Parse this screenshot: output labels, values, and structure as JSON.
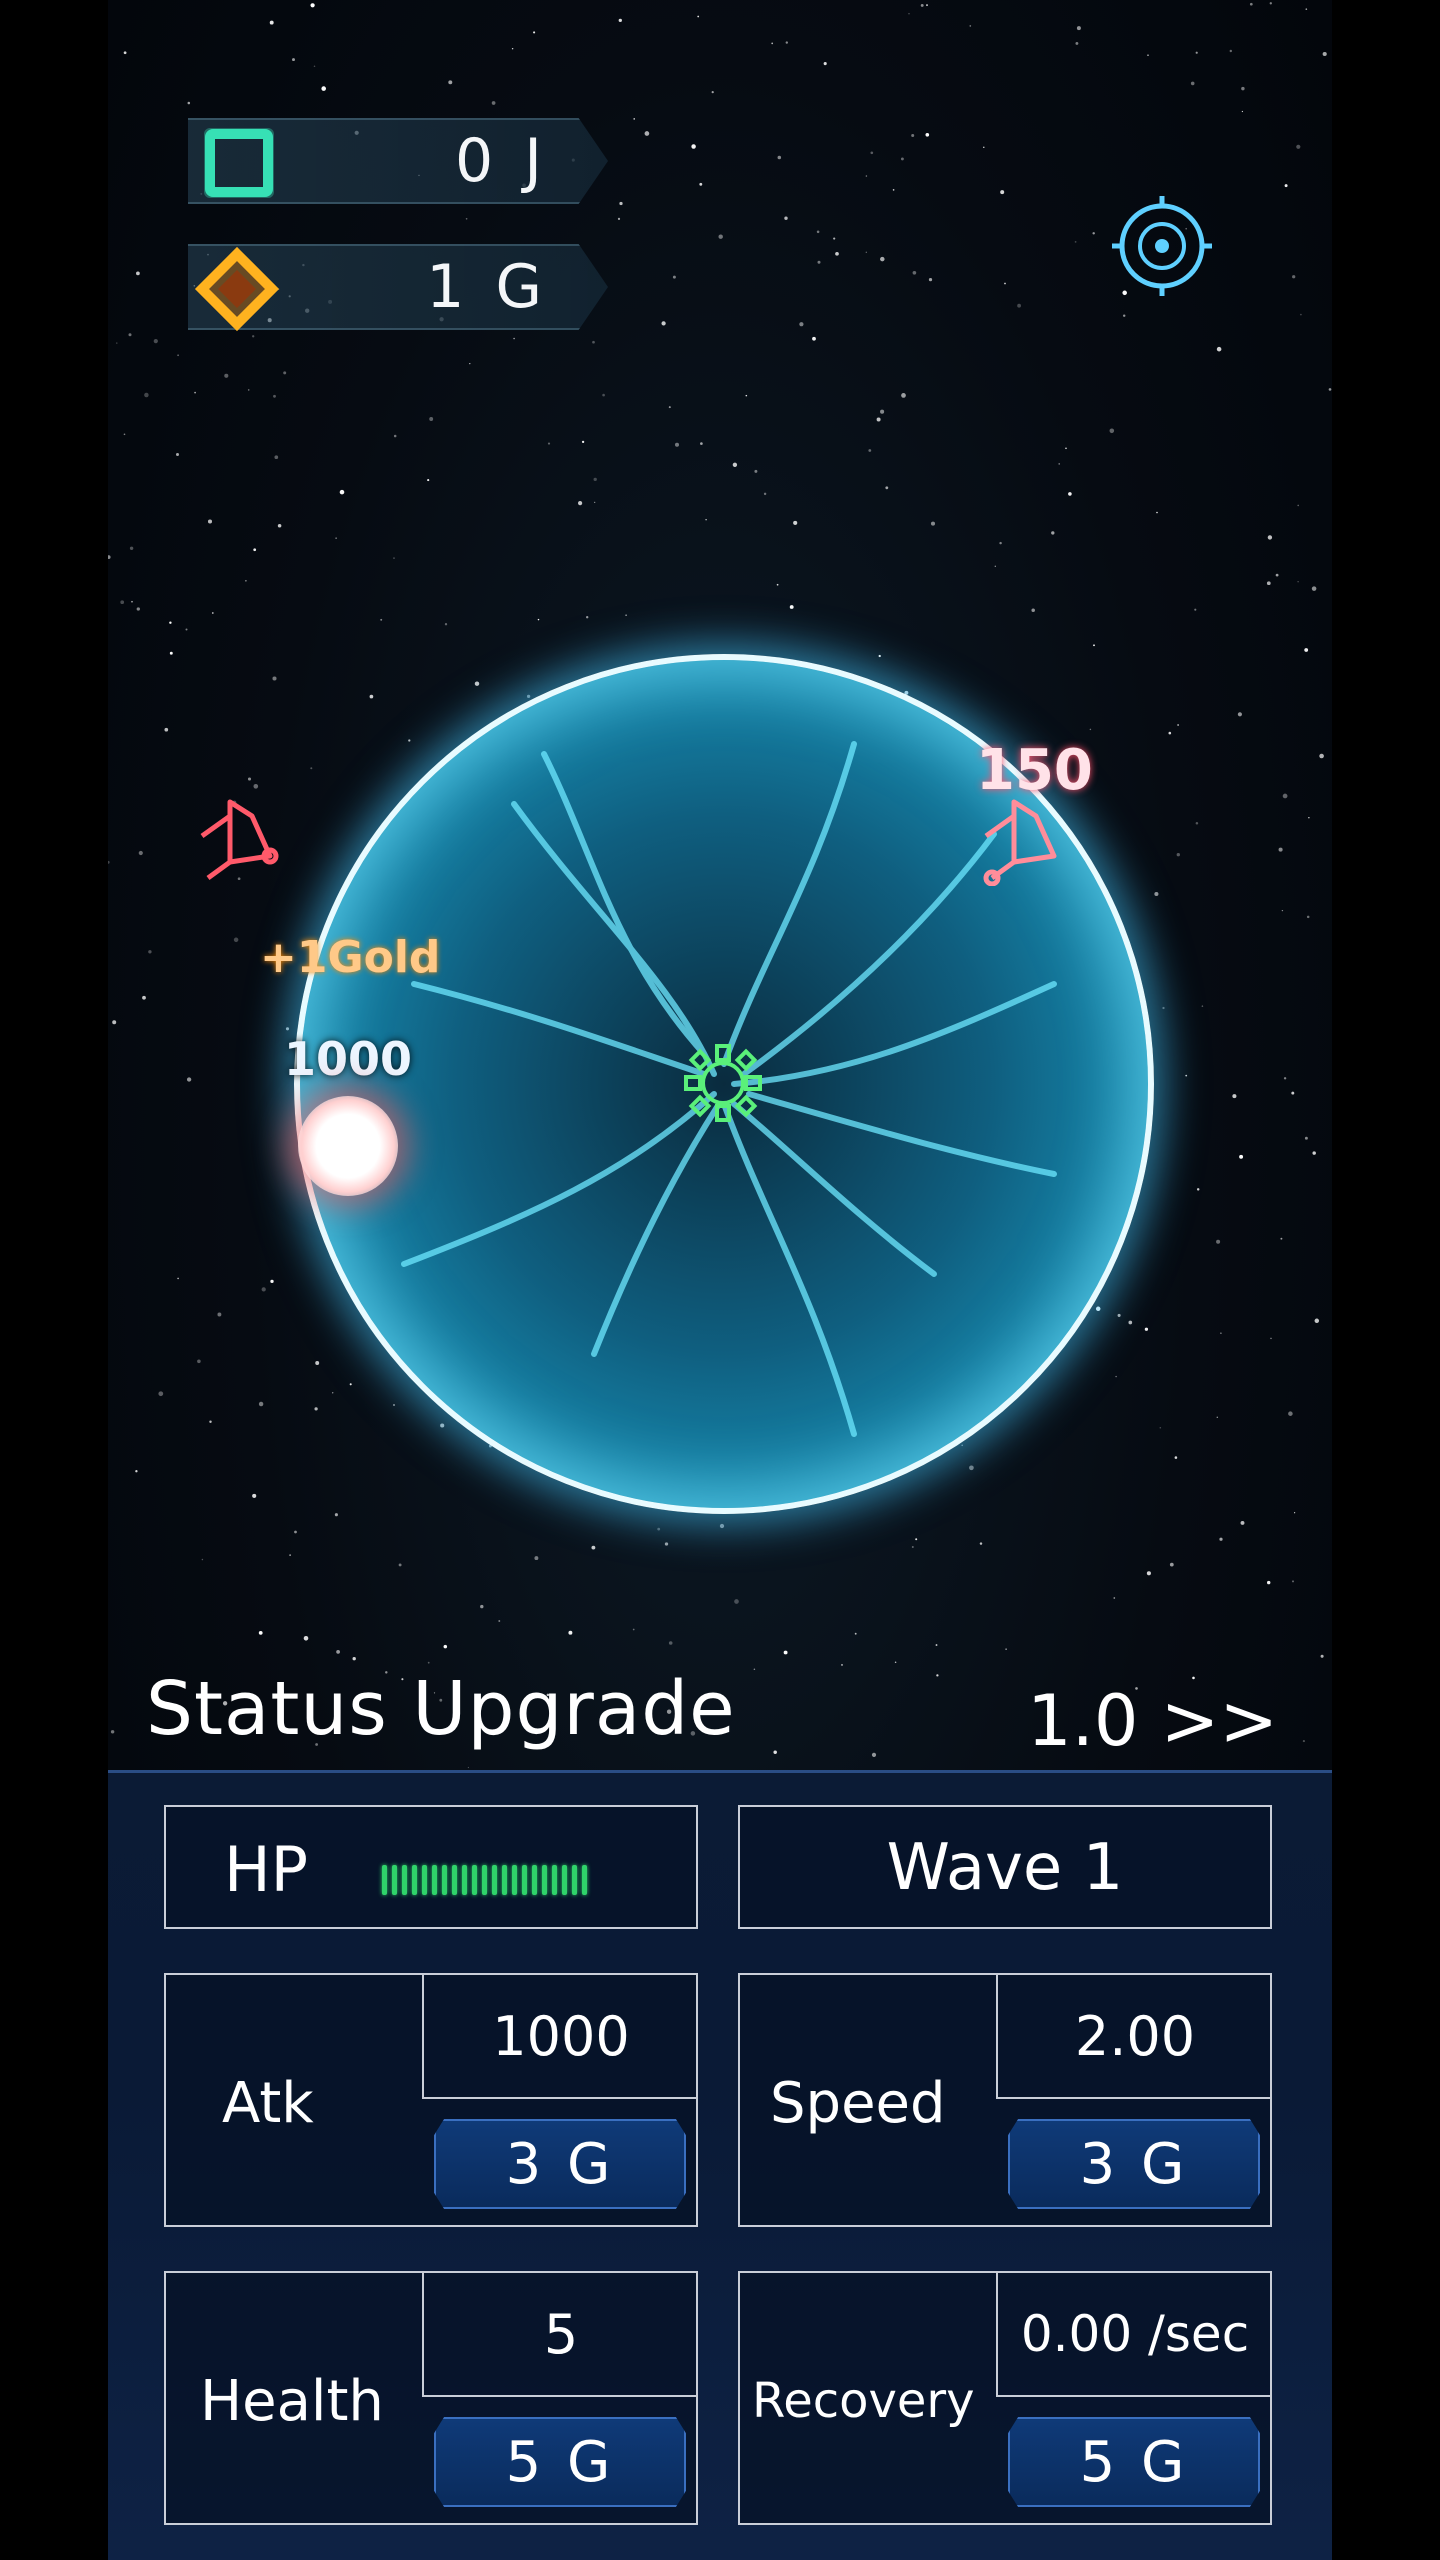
{
  "resources": {
    "energy": {
      "value": "0 J",
      "icon": "green-square-icon",
      "color": "#37e0b5"
    },
    "gold": {
      "value": "1 G",
      "icon": "orange-diamond-icon",
      "color": "#ffa51a"
    }
  },
  "settings": {
    "icon": "target-settings-icon",
    "color": "#5fd0ff"
  },
  "battle": {
    "floating": {
      "damage_enemy": "150",
      "gold_gain": "+1Gold",
      "damage_ball": "1000"
    }
  },
  "status": {
    "title": "Status Upgrade",
    "game_speed": "1.0 >>"
  },
  "panel": {
    "hp": {
      "label": "HP",
      "bar_fill": 1.0,
      "color": "#2fd36a"
    },
    "wave": {
      "label": "Wave 1"
    },
    "upgrades": [
      {
        "name": "Atk",
        "value": "1000",
        "cost": "3 G"
      },
      {
        "name": "Speed",
        "value": "2.00",
        "cost": "3 G"
      },
      {
        "name": "Health",
        "value": "5",
        "cost": "5 G"
      },
      {
        "name": "Recovery",
        "value": "0.00 /sec",
        "cost": "5 G"
      }
    ]
  }
}
